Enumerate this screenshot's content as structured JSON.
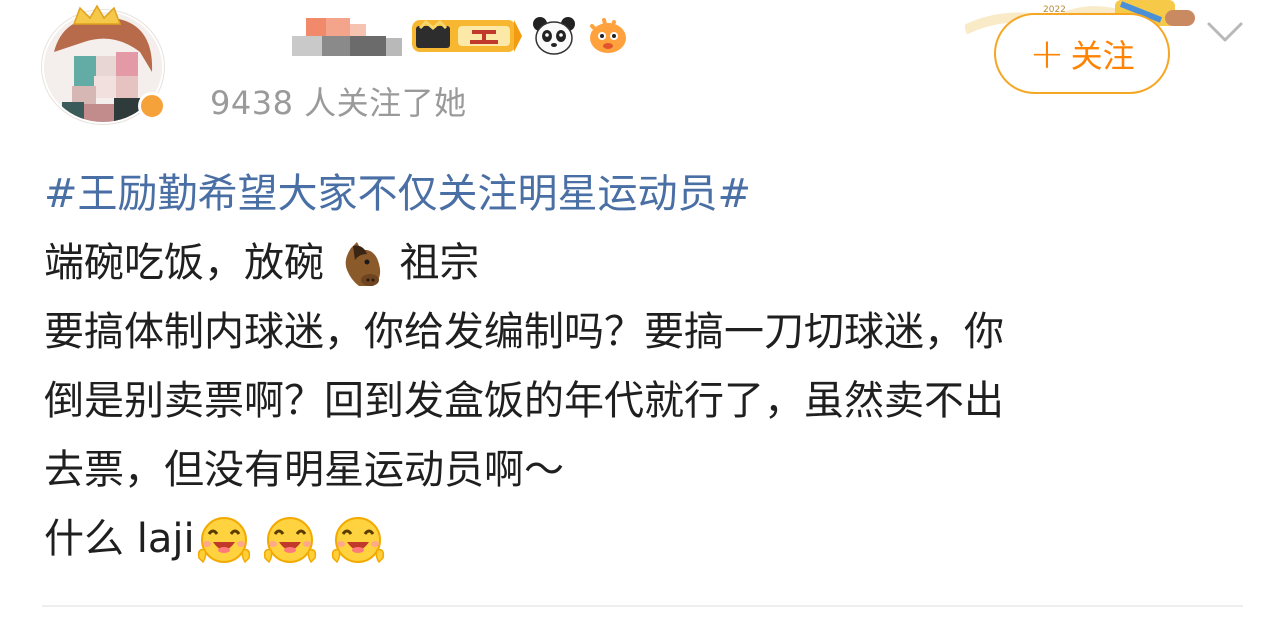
{
  "header": {
    "followers_text": "9438 人关注了她",
    "follow_button": {
      "icon": "+",
      "label": "关注"
    },
    "badges": [
      "vip-level-badge-icon",
      "panda-icon",
      "fish-icon"
    ],
    "more_icon": "chevron-down-icon",
    "banner_text": "2022"
  },
  "post": {
    "topic": "#王励勤希望大家不仅关注明星运动员#",
    "line1_a": "端碗吃饭，放碗",
    "line1_b": "祖宗",
    "line2": "要搞体制内球迷，你给发编制吗？要搞一刀切球迷，你",
    "line3": "倒是别卖票啊？回到发盒饭的年代就行了，虽然卖不出",
    "line4": "去票，但没有明星运动员啊～",
    "line5": "什么 laji",
    "emojis": [
      "horse-face-icon",
      "cheering-face-icon",
      "cheering-face-icon",
      "cheering-face-icon"
    ]
  },
  "colors": {
    "topic": "#4a6fa5",
    "follow_accent": "#ff8200",
    "follow_border": "#f5a623",
    "muted": "#9a9a9a",
    "text": "#1f1f1f"
  }
}
